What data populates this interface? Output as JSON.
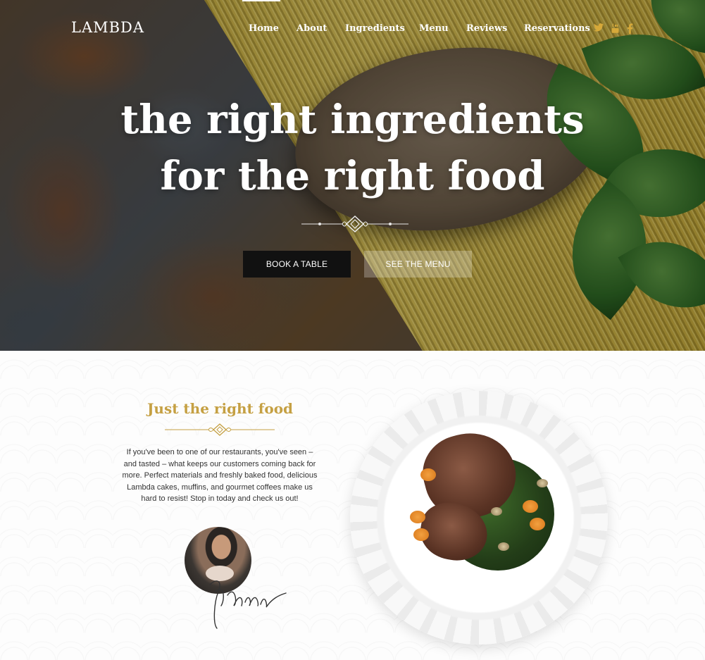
{
  "brand": {
    "logo": "LAMBDA"
  },
  "nav": {
    "items": [
      {
        "label": "Home",
        "active": true
      },
      {
        "label": "About"
      },
      {
        "label": "Ingredients"
      },
      {
        "label": "Menu"
      },
      {
        "label": "Reviews"
      },
      {
        "label": "Reservations"
      }
    ],
    "social": [
      {
        "icon": "twitter-icon",
        "glyph": "🐦"
      },
      {
        "icon": "youtube-icon",
        "glyph": "▶"
      },
      {
        "icon": "facebook-icon",
        "glyph": "f"
      }
    ],
    "active_color": "#ffffff",
    "social_color": "#d6a93a"
  },
  "hero": {
    "title_line1": "the right ingredients",
    "title_line2": "for the right food",
    "buttons": {
      "book": "Book a table",
      "menu": "See the menu"
    }
  },
  "about": {
    "title": "Just the right food",
    "text": "If you've been to one of our restaurants, you've seen – and tasted – what keeps our customers coming back for more. Perfect materials and freshly baked food, delicious Lambda cakes, muffins, and gourmet coffees make us hard to resist! Stop in today and check us out!",
    "accent_color": "#c5a043"
  }
}
